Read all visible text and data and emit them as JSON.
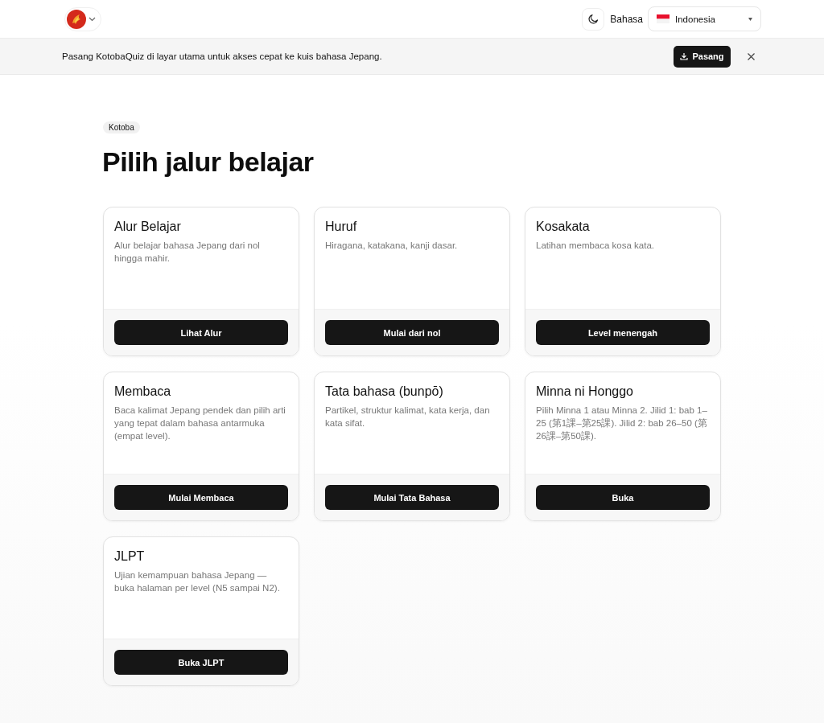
{
  "header": {
    "language_label": "Bahasa",
    "language_select": {
      "value": "Indonesia"
    }
  },
  "banner": {
    "message": "Pasang KotobaQuiz di layar utama untuk akses cepat ke kuis bahasa Jepang.",
    "install_button": "Pasang"
  },
  "page": {
    "badge": "Kotoba",
    "title": "Pilih jalur belajar"
  },
  "cards": [
    {
      "title": "Alur Belajar",
      "description": "Alur belajar bahasa Jepang dari nol hingga mahir.",
      "button": "Lihat Alur"
    },
    {
      "title": "Huruf",
      "description": "Hiragana, katakana, kanji dasar.",
      "button": "Mulai dari nol"
    },
    {
      "title": "Kosakata",
      "description": "Latihan membaca kosa kata.",
      "button": "Level menengah"
    },
    {
      "title": "Membaca",
      "description": "Baca kalimat Jepang pendek dan pilih arti yang tepat dalam bahasa antarmuka (empat level).",
      "button": "Mulai Membaca"
    },
    {
      "title": "Tata bahasa (bunpō)",
      "description": "Partikel, struktur kalimat, kata kerja, dan kata sifat.",
      "button": "Mulai Tata Bahasa"
    },
    {
      "title": "Minna ni Honggo",
      "description": "Pilih Minna 1 atau Minna 2. Jilid 1: bab 1–25 (第1課–第25課). Jilid 2: bab 26–50 (第26課–第50課).",
      "button": "Buka"
    },
    {
      "title": "JLPT",
      "description": "Ujian kemampuan bahasa Jepang — buka halaman per level (N5 sampai N2).",
      "button": "Buka JLPT"
    }
  ]
}
